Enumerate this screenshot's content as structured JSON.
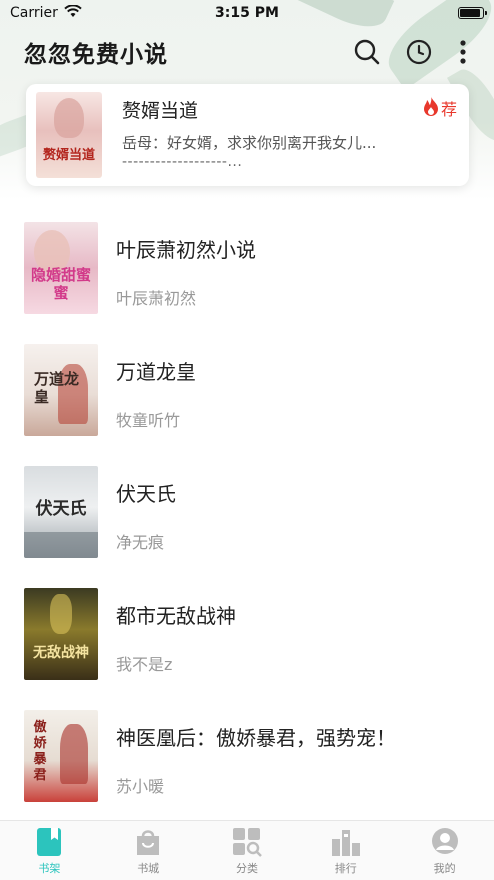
{
  "status_bar": {
    "carrier": "Carrier",
    "time": "3:15 PM"
  },
  "header": {
    "title": "忽忽免费小说"
  },
  "recommend": {
    "title": "赘婿当道",
    "desc": "岳母：好女婿，求求你别离开我女儿...",
    "dash": "-------------------...",
    "badge": "荐",
    "cover_text": "赘婿当道"
  },
  "books": [
    {
      "title": "叶辰萧初然小说",
      "author": "叶辰萧初然",
      "cover_text": "隐婚甜蜜蜜"
    },
    {
      "title": "万道龙皇",
      "author": "牧童听竹",
      "cover_text": "万道龙皇"
    },
    {
      "title": "伏天氏",
      "author": "净无痕",
      "cover_text": "伏天氏"
    },
    {
      "title": "都市无敌战神",
      "author": "我不是z",
      "cover_text": "无敌战神"
    },
    {
      "title": "神医凰后：傲娇暴君，强势宠！",
      "author": "苏小暖",
      "cover_text": "傲娇暴君"
    }
  ],
  "tabs": [
    {
      "label": "书架",
      "icon": "bookshelf-icon",
      "active": true
    },
    {
      "label": "书城",
      "icon": "bookstore-icon",
      "active": false
    },
    {
      "label": "分类",
      "icon": "category-icon",
      "active": false
    },
    {
      "label": "排行",
      "icon": "ranking-icon",
      "active": false
    },
    {
      "label": "我的",
      "icon": "profile-icon",
      "active": false
    }
  ],
  "colors": {
    "accent": "#2cc4bd",
    "hot": "#e8382c"
  }
}
